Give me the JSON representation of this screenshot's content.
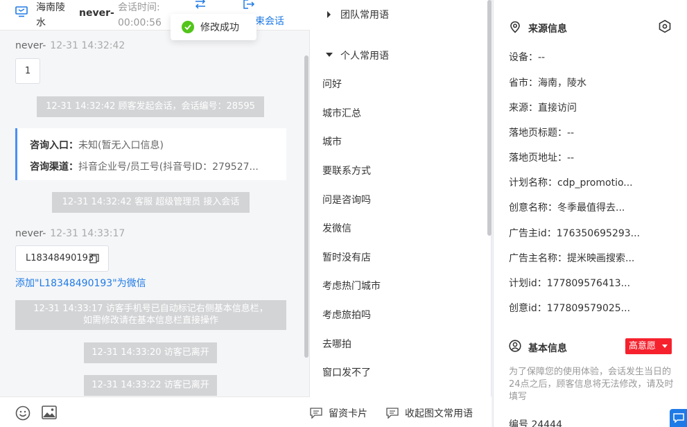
{
  "header": {
    "location": "海南陵水",
    "visitor_name": "never-",
    "session_time_label": "会话时间:",
    "session_time": "00:00:56",
    "end_session_label": "束会话"
  },
  "toast": {
    "text": "修改成功"
  },
  "messages": {
    "msg1_sender": "never-",
    "msg1_time": "12-31 14:32:42",
    "msg1_text": "1",
    "sys1": "12-31 14:32:42 顾客发起会话，会话编号：28595",
    "card_entry_label": "咨询入口：",
    "card_entry_value": "未知(暂无入口信息)",
    "card_channel_label": "咨询渠道：",
    "card_channel_value": "抖音企业号/员工号(抖音号ID：279527...",
    "sys2": "12-31 14:32:42 客服 超级管理员 接入会话",
    "msg2_sender": "never-",
    "msg2_time": "12-31 14:33:17",
    "msg2_text": "L18348490193",
    "wechat_link": "添加\"L18348490193\"为微信",
    "sys3_line1": "12-31 14:33:17 访客手机号已自动标记右侧基本信息栏，",
    "sys3_line2": "如需修改请在基本信息栏直接操作",
    "sys4": "12-31 14:33:20 访客已离开",
    "sys5": "12-31 14:33:22 访客已离开"
  },
  "phrases": {
    "group_team": "团队常用语",
    "group_personal": "个人常用语",
    "items": [
      "问好",
      "城市汇总",
      "城市",
      "要联系方式",
      "问是咨询吗",
      "发微信",
      "暂时没有店",
      "考虑热门城市",
      "考虑旅拍吗",
      "去哪拍",
      "窗口发不了"
    ],
    "footer_card": "留资卡片",
    "footer_collapse": "收起图文常用语"
  },
  "source": {
    "title": "来源信息",
    "device": "设备：--",
    "province": "省市：海南，陵水",
    "origin": "来源：直接访问",
    "landing_title": "落地页标题：--",
    "landing_url": "落地页地址：--",
    "plan_name": "计划名称：cdp_promotio...",
    "creative_name": "创意名称：冬季最值得去...",
    "advertiser_id": "广告主id：176350695293...",
    "advertiser_name": "广告主名称：提米映画搜索...",
    "plan_id": "计划id：177809576413...",
    "creative_id": "创意id：177809579025..."
  },
  "basic": {
    "title": "基本信息",
    "intent": "高意愿",
    "notice": "为了保障您的使用体验，会话发生当日的24点之后，顾客信息将无法修改，请及时填写",
    "number": "编号    24444"
  },
  "colors": {
    "accent": "#1e7ae6",
    "success": "#52c41a",
    "badge": "#f5222d"
  }
}
